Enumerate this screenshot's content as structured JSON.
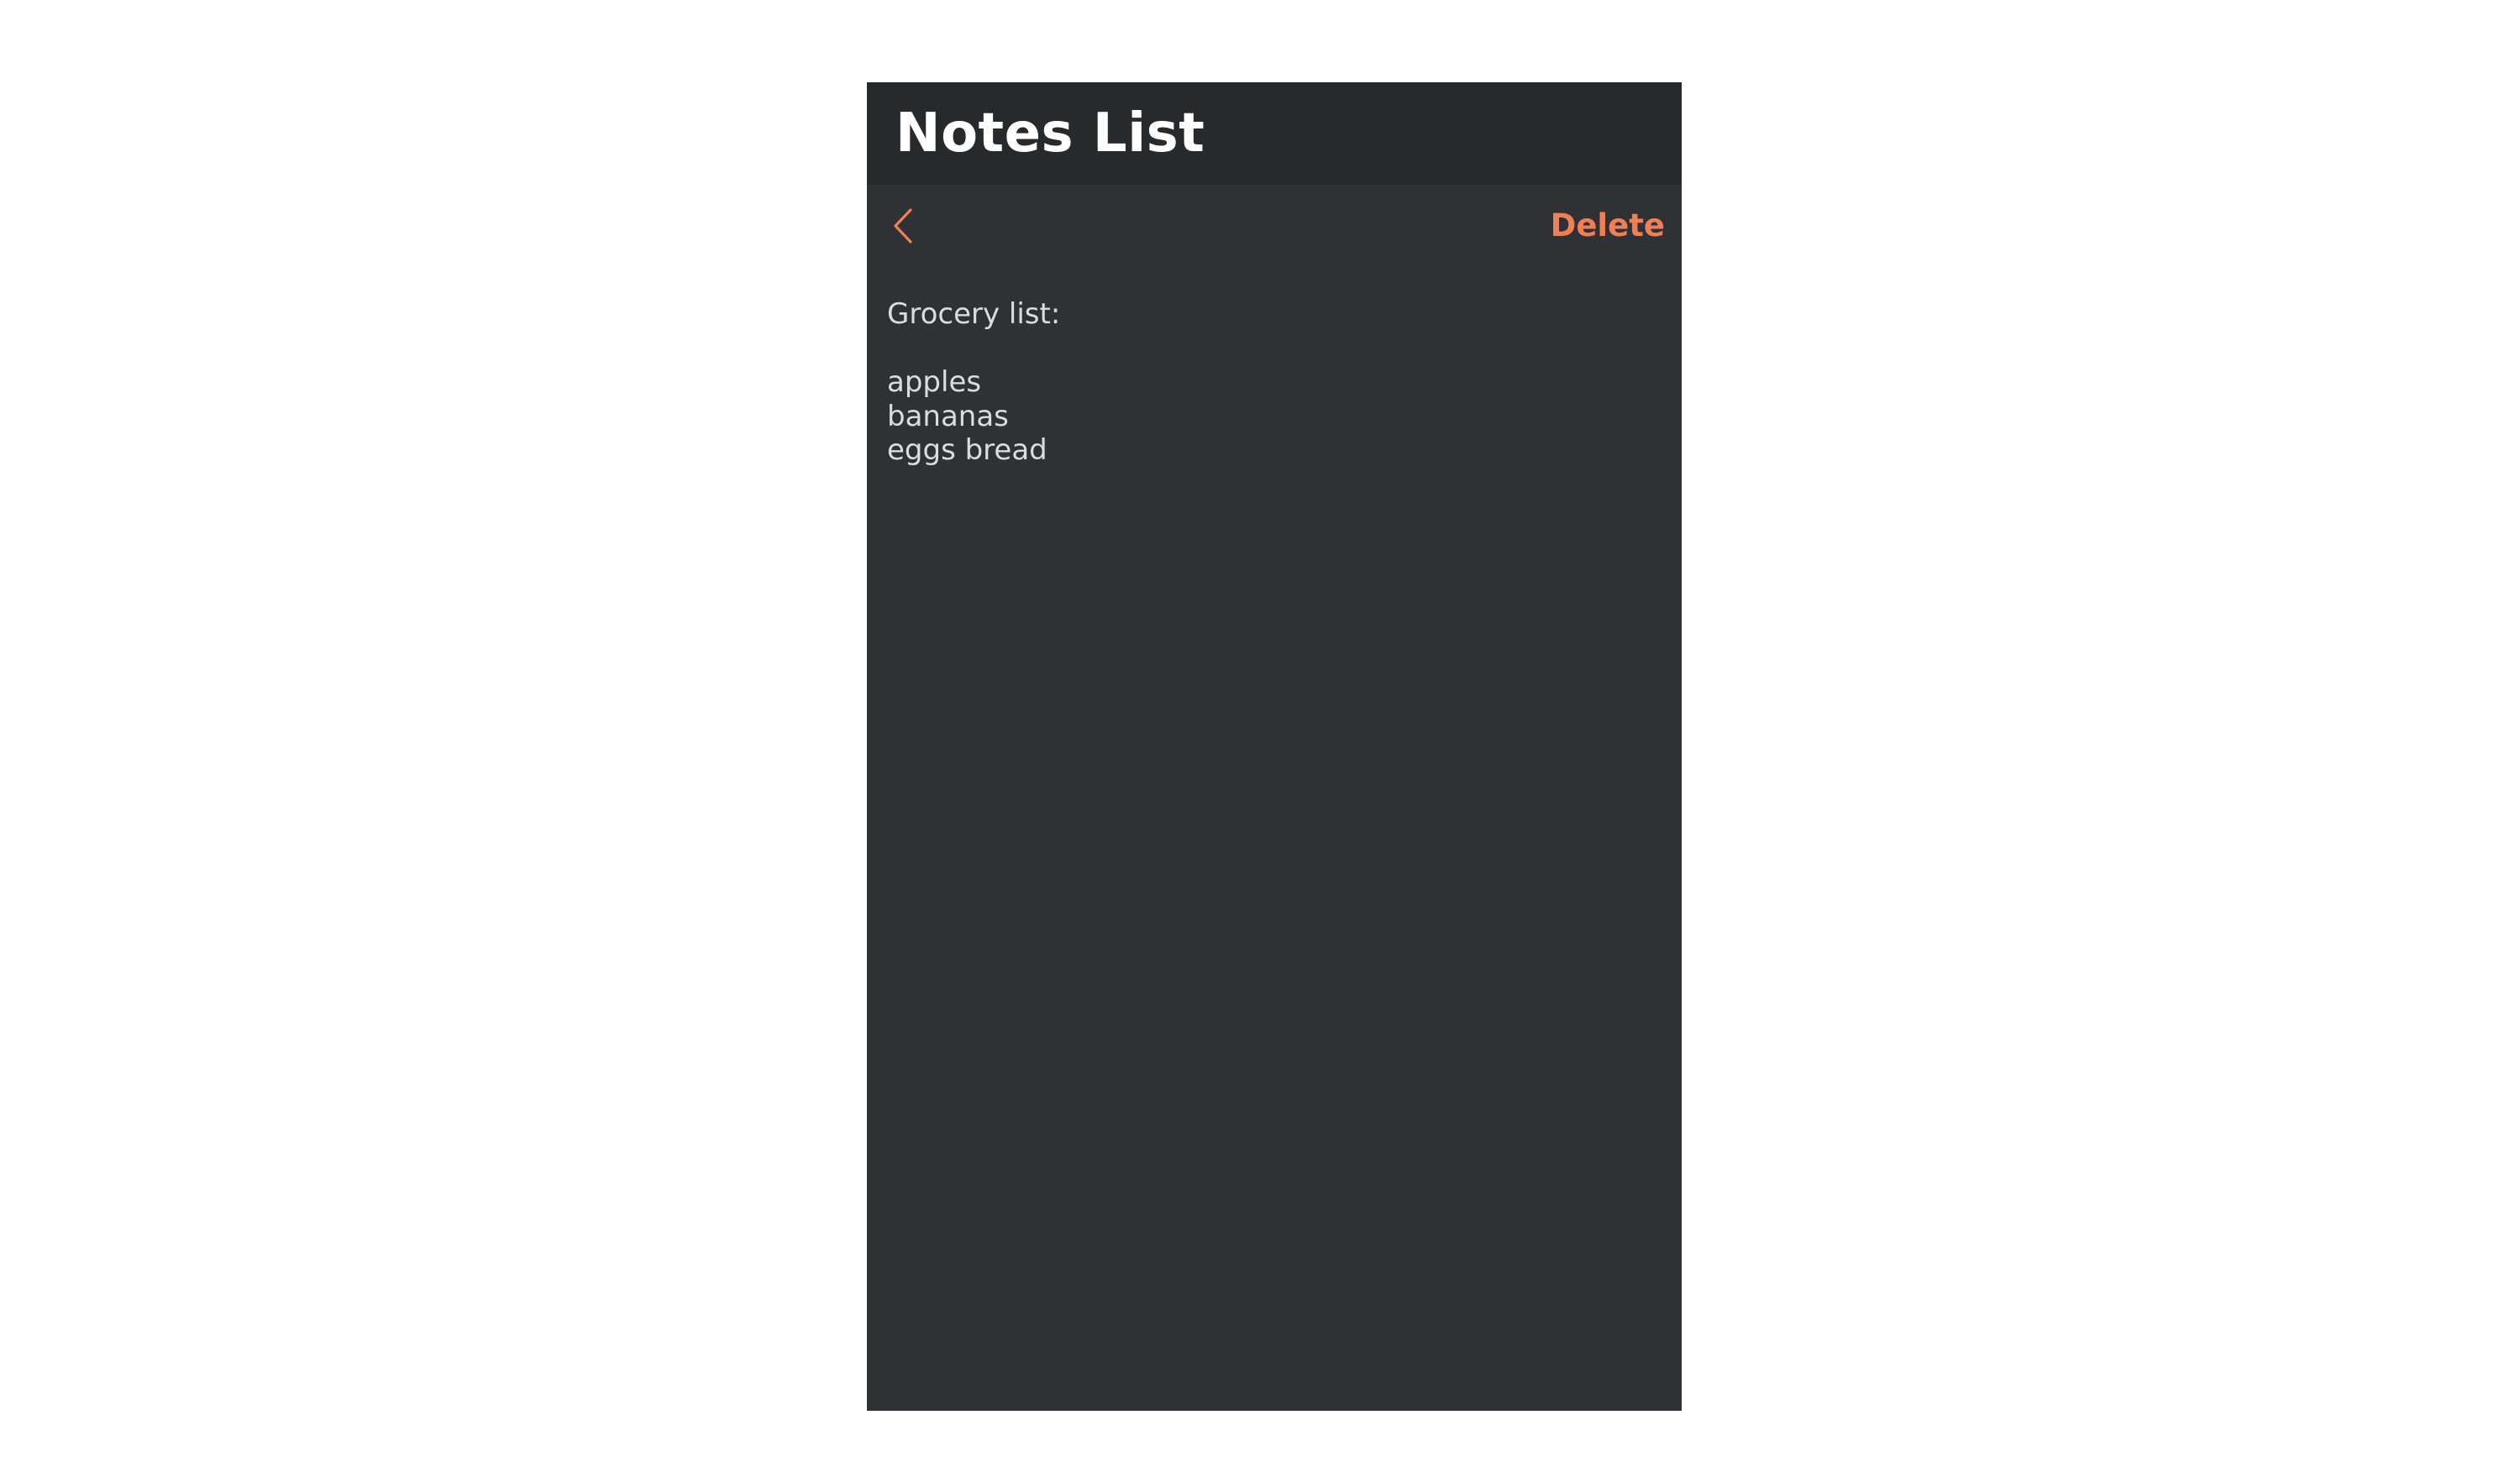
{
  "app": {
    "title": "Notes List"
  },
  "toolbar": {
    "back_icon": "chevron-left-icon",
    "delete_label": "Delete"
  },
  "note": {
    "lines": [
      "Grocery list:",
      "",
      "apples",
      "bananas",
      "eggs bread"
    ]
  },
  "colors": {
    "accent": "#f07f55",
    "header_bg": "#28292b",
    "body_bg": "#2f3134",
    "text": "#dcdcdc",
    "title_text": "#ffffff"
  }
}
